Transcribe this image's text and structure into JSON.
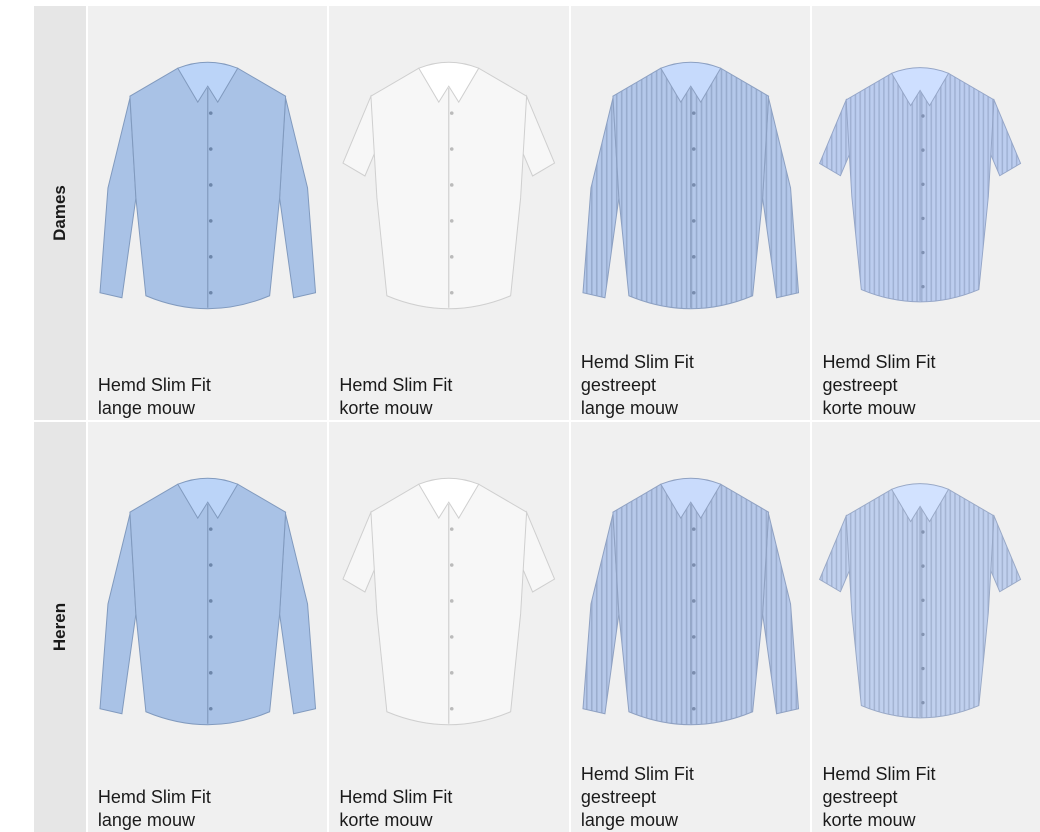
{
  "rows": [
    {
      "label": "Dames",
      "items": [
        {
          "lines": [
            "Hemd Slim Fit",
            "lange mouw"
          ],
          "color": "#a9c2e6",
          "pattern": "plain",
          "sleeve": "long"
        },
        {
          "lines": [
            "Hemd Slim Fit",
            "korte mouw"
          ],
          "color": "#f7f7f7",
          "pattern": "plain",
          "sleeve": "short"
        },
        {
          "lines": [
            "Hemd Slim Fit",
            "gestreept",
            "lange mouw"
          ],
          "color": "#b4c8ea",
          "pattern": "striped",
          "sleeve": "long"
        },
        {
          "lines": [
            "Hemd Slim Fit",
            "gestreept",
            "korte mouw"
          ],
          "color": "#bccdef",
          "pattern": "striped",
          "sleeve": "short"
        }
      ]
    },
    {
      "label": "Heren",
      "items": [
        {
          "lines": [
            "Hemd Slim Fit",
            "lange mouw"
          ],
          "color": "#a9c2e6",
          "pattern": "plain",
          "sleeve": "long"
        },
        {
          "lines": [
            "Hemd Slim Fit",
            "korte mouw"
          ],
          "color": "#f7f7f7",
          "pattern": "plain",
          "sleeve": "short"
        },
        {
          "lines": [
            "Hemd Slim Fit",
            "gestreept",
            "lange mouw"
          ],
          "color": "#b7c9ea",
          "pattern": "striped",
          "sleeve": "long"
        },
        {
          "lines": [
            "Hemd Slim Fit",
            "gestreept",
            "korte mouw"
          ],
          "color": "#c0d0ee",
          "pattern": "striped",
          "sleeve": "short"
        }
      ]
    }
  ]
}
